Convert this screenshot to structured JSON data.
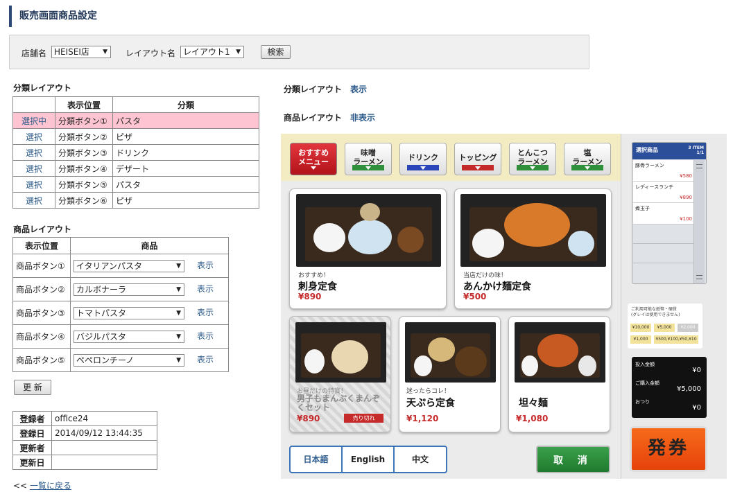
{
  "page_title": "販売画面商品設定",
  "search": {
    "store_label": "店舗名",
    "store_value": "HEISEI店",
    "layout_label": "レイアウト名",
    "layout_value": "レイアウト1",
    "search_button": "検索"
  },
  "category_layout": {
    "title": "分類レイアウト",
    "headers": [
      "",
      "表示位置",
      "分類"
    ],
    "rows": [
      {
        "action": "選択中",
        "position": "分類ボタン①",
        "category": "パスタ"
      },
      {
        "action": "選択",
        "position": "分類ボタン②",
        "category": "ピザ"
      },
      {
        "action": "選択",
        "position": "分類ボタン③",
        "category": "ドリンク"
      },
      {
        "action": "選択",
        "position": "分類ボタン④",
        "category": "デザート"
      },
      {
        "action": "選択",
        "position": "分類ボタン⑤",
        "category": "パスタ"
      },
      {
        "action": "選択",
        "position": "分類ボタン⑥",
        "category": "ピザ"
      }
    ]
  },
  "product_layout": {
    "title": "商品レイアウト",
    "headers": [
      "表示位置",
      "商品"
    ],
    "rows": [
      {
        "position": "商品ボタン①",
        "product": "イタリアンパスタ",
        "link": "表示"
      },
      {
        "position": "商品ボタン②",
        "product": "カルボナーラ",
        "link": "表示"
      },
      {
        "position": "商品ボタン③",
        "product": "トマトパスタ",
        "link": "表示"
      },
      {
        "position": "商品ボタン④",
        "product": "バジルパスタ",
        "link": "表示"
      },
      {
        "position": "商品ボタン⑤",
        "product": "ペペロンチーノ",
        "link": "表示"
      }
    ],
    "update_button": "更 新"
  },
  "info": {
    "registrant_label": "登録者",
    "registrant": "office24",
    "registered_label": "登録日",
    "registered": "2014/09/12 13:44:35",
    "updater_label": "更新者",
    "updater": "",
    "updated_label": "更新日",
    "updated": ""
  },
  "back_link": {
    "prefix": "<< ",
    "label": "一覧に戻る"
  },
  "right": {
    "category_label": "分類レイアウト",
    "category_toggle": "表示",
    "product_label": "商品レイアウト",
    "product_toggle": "非表示"
  },
  "preview": {
    "categories": [
      {
        "line1": "おすすめ",
        "line2": "メニュー",
        "band": "#222222"
      },
      {
        "line1": "味噌",
        "line2": "ラーメン",
        "band": "#2f8f3a"
      },
      {
        "line1": "ドリンク",
        "line2": "",
        "band": "#2a46b8"
      },
      {
        "line1": "トッピング",
        "line2": "",
        "band": "#c42a2a"
      },
      {
        "line1": "とんこつ",
        "line2": "ラーメン",
        "band": "#2f8f3a"
      },
      {
        "line1": "塩",
        "line2": "ラーメン",
        "band": "#2f8f3a"
      }
    ],
    "items": [
      {
        "sub": "おすすめ！",
        "name": "刺身定食",
        "price": "¥890"
      },
      {
        "sub": "当店だけの味！",
        "name": "あんかけ麺定食",
        "price": "¥500"
      },
      {
        "sub": "お昼だけの特賞！",
        "name": "男子もまんぷくまんぞくセット",
        "price": "¥890",
        "badge": "売り切れ"
      },
      {
        "sub": "迷ったらコレ！",
        "name": "天ぷら定食",
        "price": "¥1,120"
      },
      {
        "sub": "",
        "name": "坦々麺",
        "price": "¥1,080"
      }
    ],
    "languages": [
      "日本語",
      "English",
      "中文"
    ],
    "cancel": "取 消",
    "cart": {
      "title": "選択商品",
      "count": "3 ITEM",
      "page": "1/1",
      "items": [
        {
          "name": "豚骨ラーメン",
          "price": "¥580"
        },
        {
          "name": "レディースランチ",
          "price": "¥890"
        },
        {
          "name": "煮玉子",
          "price": "¥100"
        }
      ]
    },
    "money_notice": "ご利用可能な紙幣・硬貨\n(グレイは使用できません)",
    "money_chips": [
      "¥10,000",
      "¥5,000",
      "¥2,000",
      "¥1,000",
      "¥500,¥100,¥50,¥10"
    ],
    "display": [
      {
        "label": "投入金額",
        "value": "¥0"
      },
      {
        "label": "ご購入金額",
        "value": "¥5,000"
      },
      {
        "label": "おつり",
        "value": "¥0"
      }
    ],
    "issue_button": "発券"
  }
}
